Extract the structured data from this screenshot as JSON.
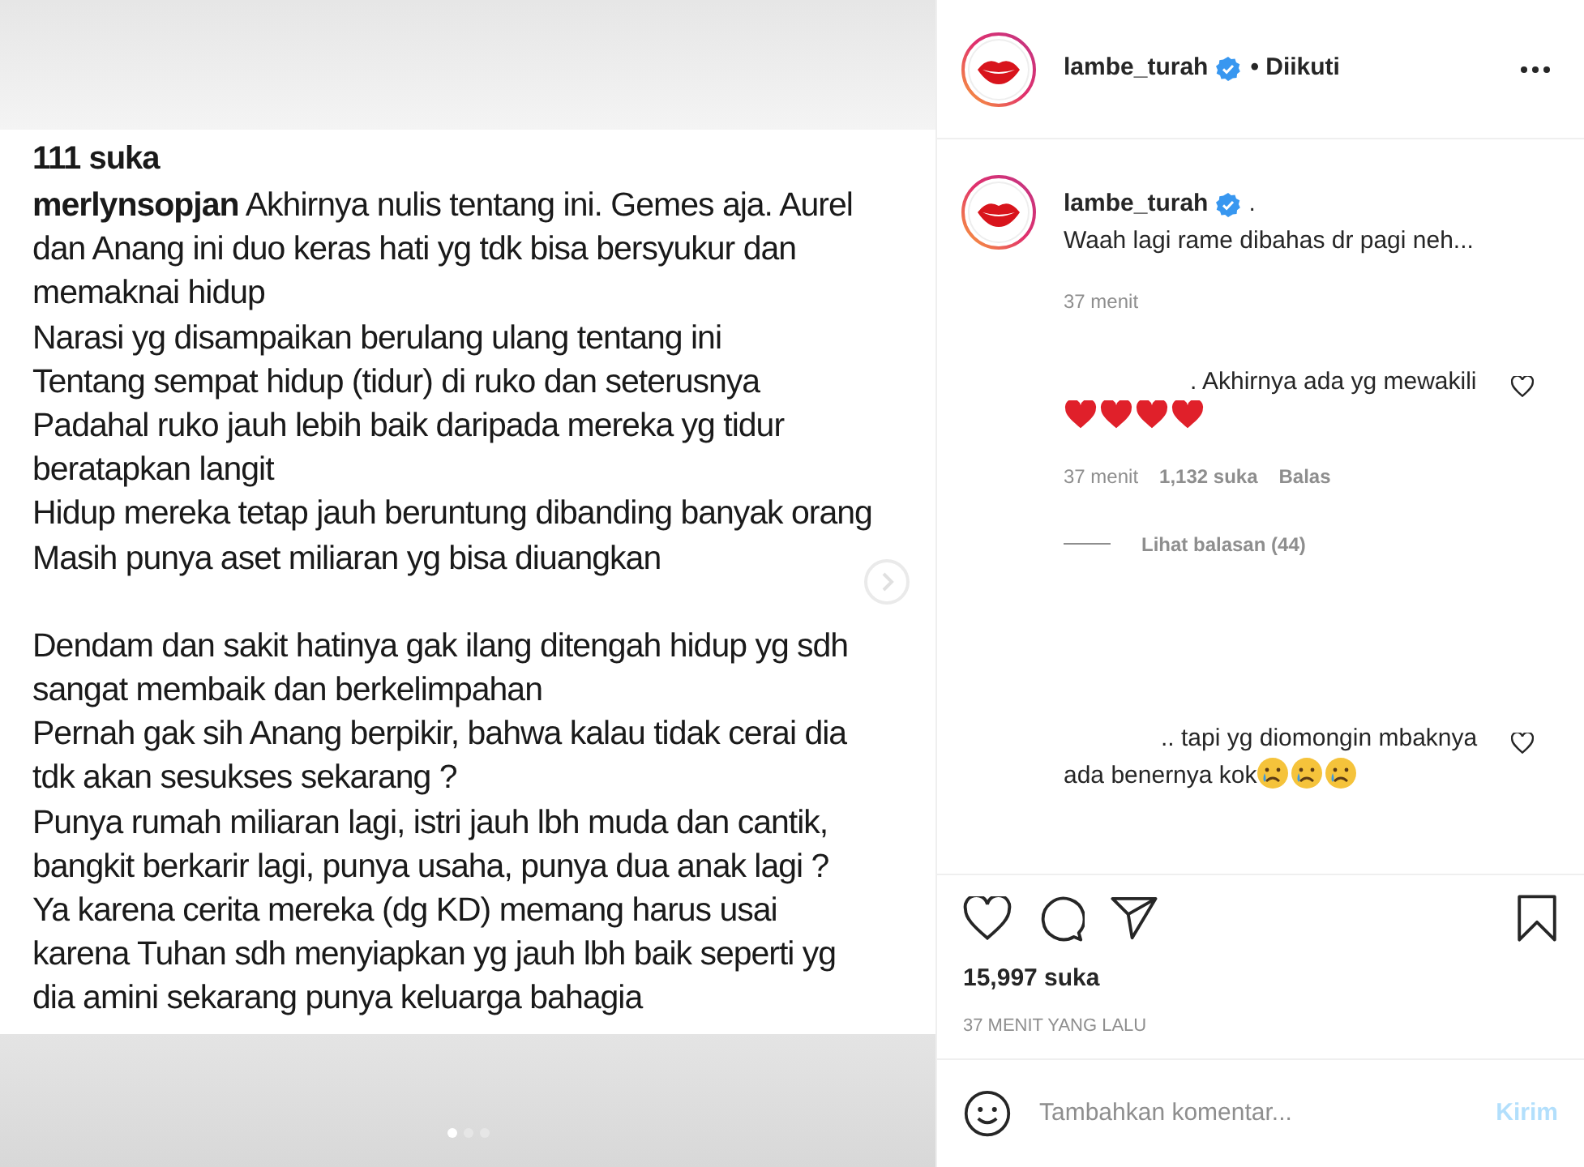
{
  "post_image": {
    "likes": "111 suka",
    "username": "merlynsopjan",
    "paragraphs": [
      [
        "Akhirnya nulis tentang ini. Gemes aja. Aurel",
        "dan Anang ini duo keras hati yg tdk bisa bersyukur dan",
        "memaknai hidup",
        "Narasi yg disampaikan berulang ulang tentang ini",
        "Tentang sempat hidup (tidur) di ruko dan seterusnya",
        "Padahal ruko jauh lebih baik daripada mereka yg tidur",
        "beratapkan langit",
        "Hidup mereka tetap jauh beruntung dibanding banyak orang",
        "Masih punya aset miliaran yg bisa diuangkan"
      ],
      [
        "Dendam dan sakit hatinya gak ilang ditengah hidup yg sdh",
        "sangat membaik dan berkelimpahan",
        "Pernah gak sih Anang berpikir, bahwa kalau tidak cerai dia",
        "tdk akan sesukses sekarang ?",
        "Punya rumah miliaran lagi, istri jauh lbh muda dan cantik,",
        "bangkit berkarir lagi, punya usaha, punya dua anak lagi ?",
        "Ya karena cerita mereka (dg KD) memang harus usai",
        "karena Tuhan sdh menyiapkan yg jauh lbh baik seperti yg",
        "dia amini sekarang punya keluarga bahagia"
      ]
    ],
    "dots": [
      {
        "selected": true
      },
      {
        "selected": false
      },
      {
        "selected": false
      }
    ]
  },
  "header": {
    "username": "lambe_turah",
    "verified": true,
    "follow_status": "• Diikuti"
  },
  "caption": {
    "username": "lambe_turah",
    "verified": true,
    "suffix": ".",
    "text": "Waah lagi rame dibahas dr pagi neh...",
    "time": "37 menit"
  },
  "comments": [
    {
      "text": ". Akhirnya ada yg mewakili",
      "kind": "hearts",
      "meta": [
        {
          "kind": "time",
          "text": "37 menit"
        },
        {
          "kind": "likes",
          "text": "1,132 suka"
        },
        {
          "kind": "reply",
          "text": "Balas"
        }
      ],
      "replies": "Lihat balasan (44)"
    },
    {
      "text": ".. tapi yg diomongin mbaknya ada benernya kok",
      "kind": "crying"
    }
  ],
  "likes": "15,997 suka",
  "timestamp": "37 MENIT YANG LALU",
  "comment_box": {
    "placeholder": "Tambahkan komentar...",
    "submit": "Kirim"
  }
}
